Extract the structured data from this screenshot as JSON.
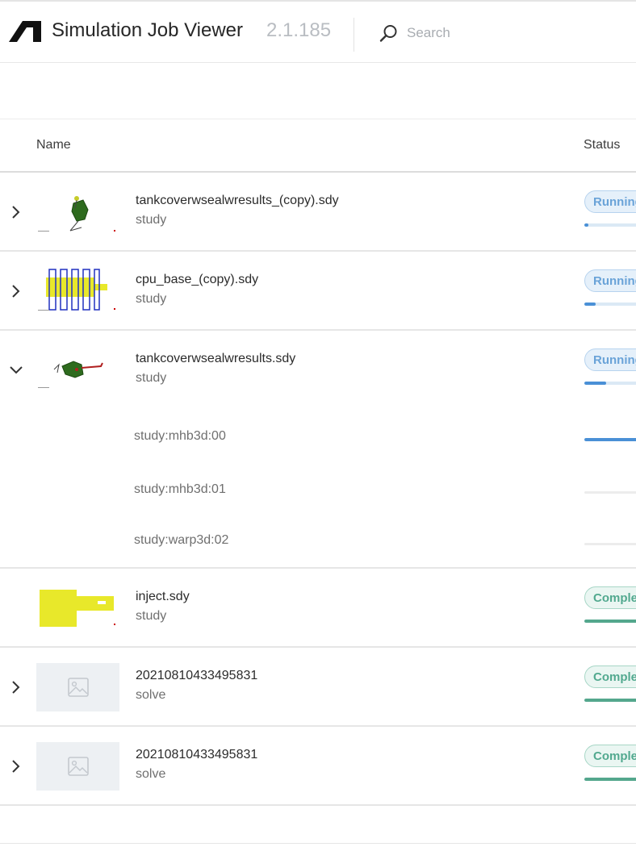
{
  "header": {
    "title": "Simulation Job Viewer",
    "version": "2.1.185",
    "search_placeholder": "Search"
  },
  "table": {
    "columns": {
      "name": "Name",
      "status": "Status"
    },
    "rows": [
      {
        "name": "tankcoverwsealwresults_(copy).sdy",
        "type": "study",
        "status": "Running",
        "progress": 0.05,
        "expanded": false,
        "thumbnail": "tank-cover-model-thumbnail"
      },
      {
        "name": "cpu_base_(copy).sdy",
        "type": "study",
        "status": "Running",
        "progress": 0.15,
        "expanded": false,
        "thumbnail": "cpu-base-model-thumbnail"
      },
      {
        "name": "tankcoverwsealwresults.sdy",
        "type": "study",
        "status": "Running",
        "progress": 0.3,
        "expanded": true,
        "thumbnail": "tank-cover-model-thumbnail",
        "subjobs": [
          {
            "name": "study:mhb3d:00",
            "progress": 1.0
          },
          {
            "name": "study:mhb3d:01",
            "progress": 0.0
          },
          {
            "name": "study:warp3d:02",
            "progress": 0.0
          }
        ]
      },
      {
        "name": "inject.sdy",
        "type": "study",
        "status": "Complete",
        "progress": 1.0,
        "expanded": null,
        "thumbnail": "inject-model-thumbnail"
      },
      {
        "name": "20210810433495831",
        "type": "solve",
        "status": "Complete",
        "progress": 1.0,
        "expanded": false,
        "thumbnail": "image-placeholder-icon"
      },
      {
        "name": "20210810433495831",
        "type": "solve",
        "status": "Complete",
        "progress": 1.0,
        "expanded": false,
        "thumbnail": "image-placeholder-icon"
      }
    ]
  },
  "colors": {
    "running": "#4a90d6",
    "complete": "#54a78d",
    "accent_text": "#262626"
  }
}
